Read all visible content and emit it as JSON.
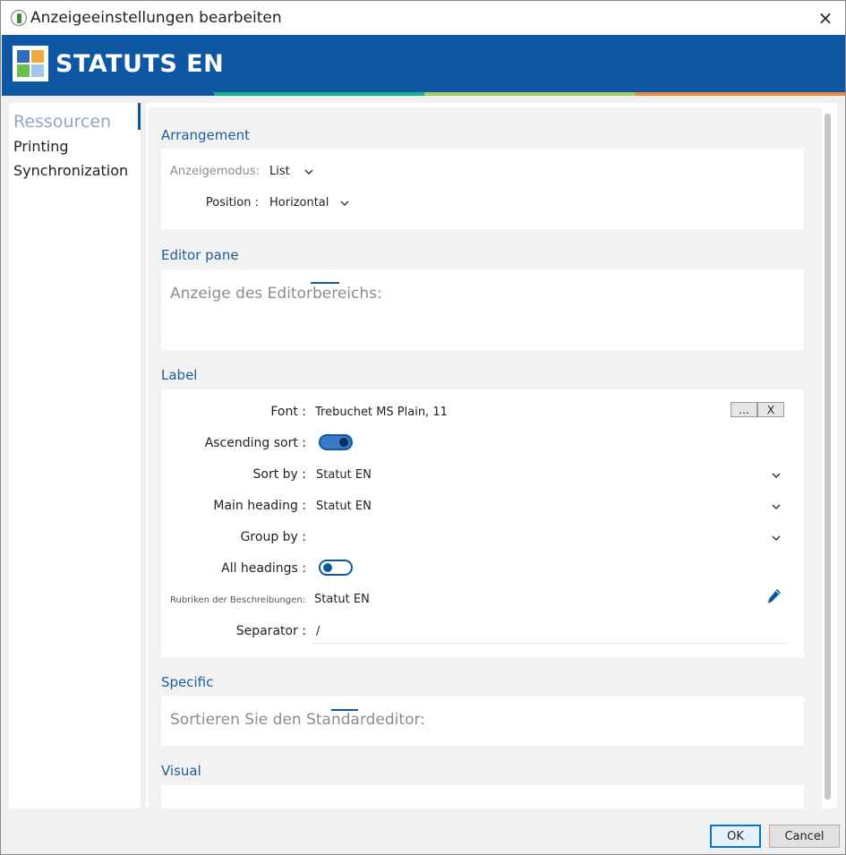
{
  "window": {
    "title": "Anzeigeeinstellungen bearbeiten",
    "close_icon": "×"
  },
  "banner": {
    "title": "STATUTS EN",
    "logo_colors": [
      "#2f6db5",
      "#f2a93b",
      "#6cbf4a",
      "#9ec7e8"
    ],
    "stripe_colors": [
      "#1ab394",
      "#a6cc63",
      "#f08a3c"
    ]
  },
  "sidebar": {
    "items": [
      {
        "label": "Ressourcen",
        "active": true
      },
      {
        "label": "Printing",
        "active": false
      },
      {
        "label": "Synchronization",
        "active": false
      }
    ]
  },
  "arrangement": {
    "title": "Arrangement",
    "display_mode_label": "Anzeigemodus:",
    "display_mode_value": "List",
    "position_label": "Position :",
    "position_value": "Horizontal"
  },
  "editor_pane": {
    "title": "Editor pane",
    "hint": "Anzeige des Editorbereichs:"
  },
  "label": {
    "title": "Label",
    "font_label": "Font :",
    "font_value": "Trebuchet MS Plain, 11",
    "font_browse_button": "...",
    "font_clear_button": "X",
    "ascending_sort_label": "Ascending sort :",
    "ascending_sort_on": true,
    "sort_by_label": "Sort by :",
    "sort_by_value": "Statut EN",
    "main_heading_label": "Main heading :",
    "main_heading_value": "Statut EN",
    "group_by_label": "Group by :",
    "group_by_value": "",
    "all_headings_label": "All headings :",
    "all_headings_on": false,
    "description_headings_label": "Rubriken der Beschreibungen:",
    "description_headings_value": "Statut EN",
    "separator_label": "Separator :",
    "separator_value": "/"
  },
  "specific": {
    "title": "Specific",
    "hint": "Sortieren Sie den Standardeditor:"
  },
  "visual": {
    "title": "Visual"
  },
  "footer": {
    "ok_label": "OK",
    "cancel_label": "Cancel"
  },
  "icons": {
    "chevron": "chevron-down-icon",
    "pencil": "pencil-icon",
    "close": "close-icon",
    "app": "app-icon"
  },
  "colors": {
    "brand_blue": "#0e57a3",
    "section_title": "#1e5d9a",
    "hint_gray": "#8c8c8c"
  }
}
